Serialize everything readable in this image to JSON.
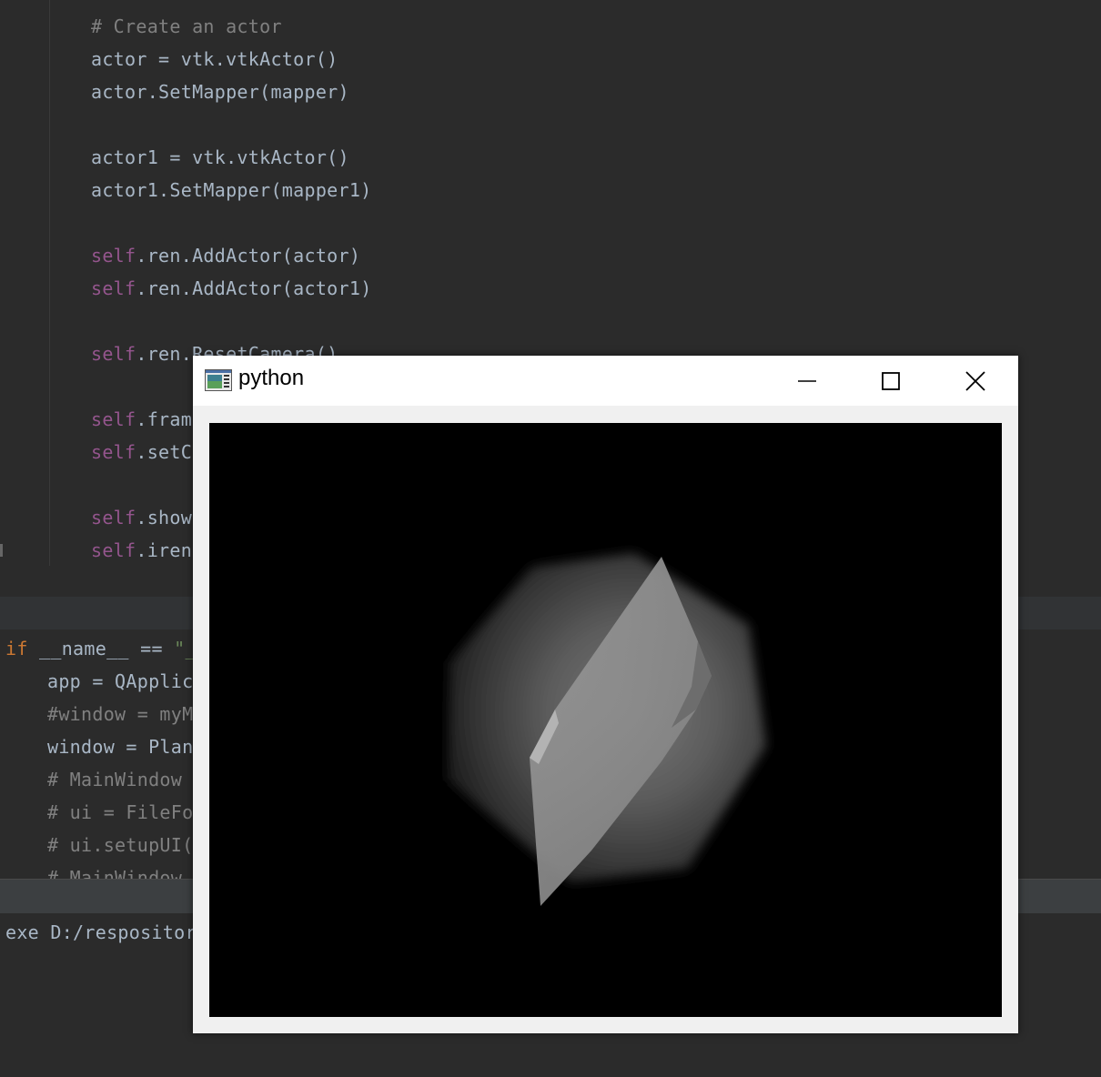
{
  "editor": {
    "code_lines": [
      {
        "text": "# Create an actor",
        "style": "comment"
      },
      {
        "text": "actor = vtk.vtkActor()",
        "style": "plain"
      },
      {
        "text": "actor.SetMapper(mapper)",
        "style": "plain"
      },
      {
        "text": "actor1 = vtk.vtkActor()",
        "style": "plain"
      },
      {
        "text": "actor1.SetMapper(mapper1)",
        "style": "plain"
      },
      {
        "self": "self",
        "text": ".ren.AddActor(actor)",
        "style": "self"
      },
      {
        "self": "self",
        "text": ".ren.AddActor(actor1)",
        "style": "self"
      },
      {
        "self": "self",
        "text": ".ren.ResetCamera()",
        "style": "self"
      },
      {
        "self": "self",
        "text": ".frame",
        "style": "self"
      },
      {
        "self": "self",
        "text": ".setCe",
        "style": "self"
      },
      {
        "self": "self",
        "text": ".show",
        "style": "self"
      },
      {
        "self": "self",
        "text": ".iren.",
        "style": "self"
      }
    ],
    "main_block": {
      "if_kw": "if",
      "if_rest": " __name__ == ",
      "if_str": "\"_",
      "lines": [
        {
          "text": "app = QApplica",
          "style": "plain"
        },
        {
          "text": "#window = myMa",
          "style": "comment"
        },
        {
          "text": "window = Plane",
          "style": "plain"
        },
        {
          "text": "# MainWindow =",
          "style": "comment"
        },
        {
          "text": "# ui = FileFol",
          "style": "comment"
        },
        {
          "text": "# ui.setupUI(M",
          "style": "comment"
        },
        {
          "text": "# MainWindow.s",
          "style": "comment"
        }
      ]
    },
    "console_line": "exe D:/respository"
  },
  "window": {
    "title": "python",
    "minimize_icon": "minimize-icon",
    "maximize_icon": "maximize-icon",
    "close_icon": "close-icon",
    "app_icon": "python-window-icon"
  },
  "colors": {
    "editor_bg": "#2b2b2b",
    "code_text": "#a9b7c6",
    "self_keyword": "#94558d",
    "if_keyword": "#cc7832",
    "comment": "#808080",
    "render_bg": "#000000"
  }
}
